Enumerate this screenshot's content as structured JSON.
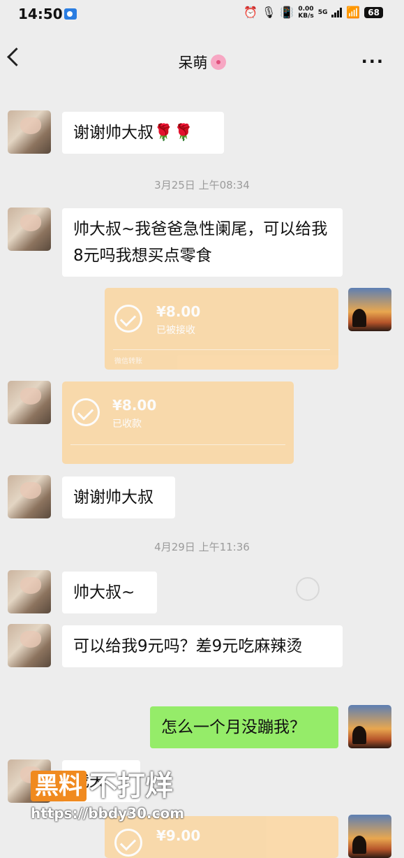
{
  "status_bar": {
    "time": "14:50",
    "speed_value": "0.00",
    "speed_unit": "KB/s",
    "network": "5G",
    "battery": "68",
    "icons": [
      "screen-record-icon",
      "alarm-icon",
      "mic-icon",
      "vibrate-icon",
      "signal-icon",
      "wifi-icon",
      "battery-icon"
    ]
  },
  "header": {
    "title": "呆萌",
    "title_icon": "cherry-blossom-icon",
    "back_icon": "chevron-left-icon",
    "more_icon": "more-dots-icon"
  },
  "messages": [
    {
      "side": "left",
      "type": "text",
      "text": "谢谢帅大叔🌹🌹"
    },
    {
      "type": "timestamp",
      "text": "3月25日 上午08:34"
    },
    {
      "side": "left",
      "type": "text",
      "text": "帅大叔~我爸爸急性阑尾，可以给我8元吗我想买点零食"
    },
    {
      "side": "right",
      "type": "transfer",
      "amount": "¥8.00",
      "status": "已被接收",
      "footer": "微信转账"
    },
    {
      "side": "left",
      "type": "transfer",
      "amount": "¥8.00",
      "status": "已收款"
    },
    {
      "side": "left",
      "type": "text",
      "text": "谢谢帅大叔"
    },
    {
      "type": "timestamp",
      "text": "4月29日 上午11:36"
    },
    {
      "side": "left",
      "type": "text",
      "text": "帅大叔~"
    },
    {
      "side": "left",
      "type": "text",
      "text": "可以给我9元吗？差9元吃麻辣烫"
    },
    {
      "side": "right",
      "type": "text",
      "text": "怎么一个月没蹦我？"
    },
    {
      "side": "left",
      "type": "text",
      "text": "我天"
    },
    {
      "side": "right",
      "type": "transfer",
      "amount": "¥9.00"
    }
  ],
  "watermark": {
    "badge": "黑料",
    "text": "不打烊",
    "url": "https://bbdy30.com"
  },
  "colors": {
    "background": "#ededed",
    "bubble_self": "#95ec69",
    "bubble_other": "#ffffff",
    "transfer": "#fbd6a0"
  }
}
